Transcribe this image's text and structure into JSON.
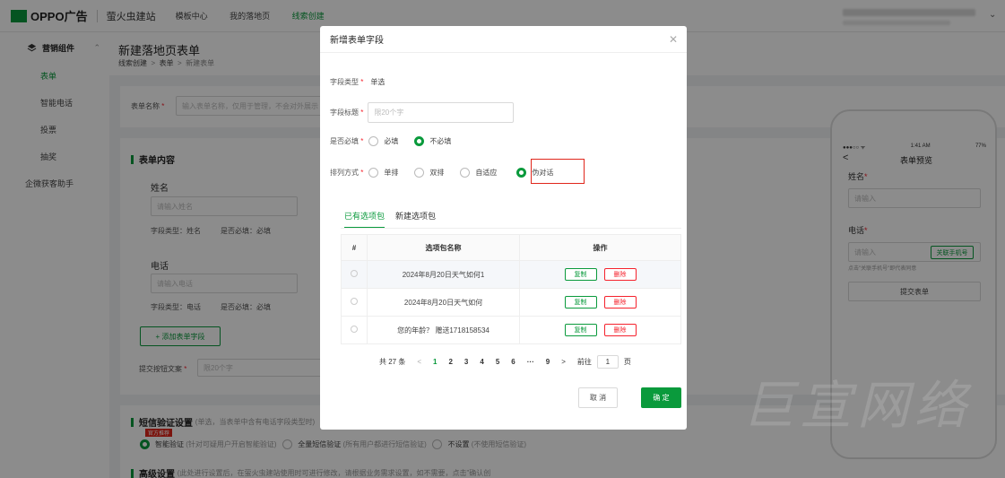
{
  "topbar": {
    "brand": "OPPO广告",
    "site": "萤火虫建站",
    "nav": [
      "模板中心",
      "我的落地页",
      "线索创建"
    ]
  },
  "sidebar": {
    "group": "营销组件",
    "items": [
      "表单",
      "智能电话",
      "投票",
      "抽奖"
    ],
    "extra": "企微获客助手"
  },
  "page": {
    "title": "新建落地页表单",
    "breadcrumb": [
      "线索创建",
      "表单",
      "新建表单"
    ],
    "form_name_label": "表单名称",
    "form_name_placeholder": "输入表单名称，仅用于管理，不会对外展示",
    "content_title": "表单内容",
    "fields": [
      {
        "name": "姓名",
        "placeholder": "请输入姓名",
        "type_meta": "字段类型：姓名",
        "req_meta": "是否必填：必填"
      },
      {
        "name": "电话",
        "placeholder": "请输入电话",
        "type_meta": "字段类型：电话",
        "req_meta": "是否必填：必填"
      }
    ],
    "add_field": "+ 添加表单字段",
    "submit_label": "提交按钮文案",
    "submit_placeholder": "限20个字",
    "sms_title": "短信验证设置",
    "sms_hint": "(单选，当表单中含有电话字段类型时)",
    "sms_badge": "官方推荐",
    "sms_options": [
      "智能验证",
      "(针对可疑用户开启智能验证)",
      "全量短信验证",
      "(所有用户都进行短信验证)",
      "不设置",
      "(不使用短信验证)"
    ],
    "adv_title": "高级设置",
    "adv_hint": "(此处进行设置后，在萤火虫建站使用时可进行修改，请根据业务需求设置，如不需要，点击\"确认创"
  },
  "preview": {
    "status_time": "1:41 AM",
    "status_batt": "77%",
    "title": "表单预览",
    "name_label": "姓名",
    "name_placeholder": "请输入",
    "phone_label": "电话",
    "phone_placeholder": "请输入",
    "link_btn": "关联手机号",
    "hint": "点击\"关联手机号\"即代表同意",
    "submit": "提交表单"
  },
  "watermark": "巨宣网络",
  "modal": {
    "title": "新增表单字段",
    "field_type_label": "字段类型",
    "field_type_value": "单选",
    "field_title_label": "字段标题",
    "field_title_placeholder": "限20个字",
    "required_label": "是否必填",
    "required_options": [
      "必填",
      "不必填"
    ],
    "required_selected": "不必填",
    "layout_label": "排列方式",
    "layout_options": [
      "单排",
      "双排",
      "自适应",
      "伪对话"
    ],
    "layout_selected": "伪对话",
    "tabs": [
      "已有选项包",
      "新建选项包"
    ],
    "table_headers": [
      "#",
      "选项包名称",
      "操作"
    ],
    "rows": [
      {
        "name": "2024年8月20日天气如何1"
      },
      {
        "name": "2024年8月20日天气如何"
      },
      {
        "name": "您的年龄？ 赠送1718158534"
      }
    ],
    "copy_label": "复制",
    "delete_label": "删除",
    "pager": {
      "total": "共 27 条",
      "pages": [
        "1",
        "2",
        "3",
        "4",
        "5",
        "6",
        "···",
        "9"
      ],
      "goto_prefix": "前往",
      "goto_value": "1",
      "goto_suffix": "页"
    },
    "cancel": "取 消",
    "ok": "确 定"
  },
  "colors": {
    "accent": "#0a9a3c",
    "danger": "#f5222d",
    "highlight": "#e0261b"
  }
}
